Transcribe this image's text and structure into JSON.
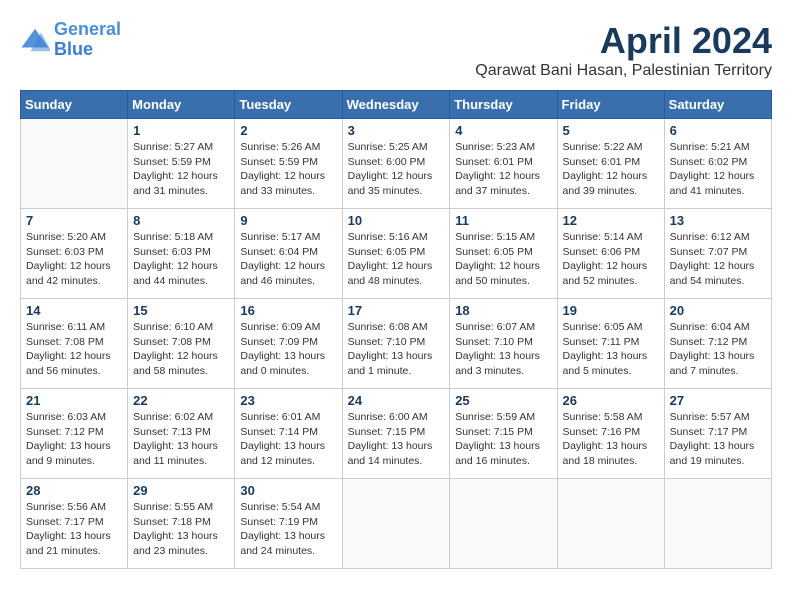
{
  "logo": {
    "line1": "General",
    "line2": "Blue"
  },
  "title": "April 2024",
  "location": "Qarawat Bani Hasan, Palestinian Territory",
  "headers": [
    "Sunday",
    "Monday",
    "Tuesday",
    "Wednesday",
    "Thursday",
    "Friday",
    "Saturday"
  ],
  "weeks": [
    [
      {
        "day": "",
        "info": ""
      },
      {
        "day": "1",
        "info": "Sunrise: 5:27 AM\nSunset: 5:59 PM\nDaylight: 12 hours\nand 31 minutes."
      },
      {
        "day": "2",
        "info": "Sunrise: 5:26 AM\nSunset: 5:59 PM\nDaylight: 12 hours\nand 33 minutes."
      },
      {
        "day": "3",
        "info": "Sunrise: 5:25 AM\nSunset: 6:00 PM\nDaylight: 12 hours\nand 35 minutes."
      },
      {
        "day": "4",
        "info": "Sunrise: 5:23 AM\nSunset: 6:01 PM\nDaylight: 12 hours\nand 37 minutes."
      },
      {
        "day": "5",
        "info": "Sunrise: 5:22 AM\nSunset: 6:01 PM\nDaylight: 12 hours\nand 39 minutes."
      },
      {
        "day": "6",
        "info": "Sunrise: 5:21 AM\nSunset: 6:02 PM\nDaylight: 12 hours\nand 41 minutes."
      }
    ],
    [
      {
        "day": "7",
        "info": "Sunrise: 5:20 AM\nSunset: 6:03 PM\nDaylight: 12 hours\nand 42 minutes."
      },
      {
        "day": "8",
        "info": "Sunrise: 5:18 AM\nSunset: 6:03 PM\nDaylight: 12 hours\nand 44 minutes."
      },
      {
        "day": "9",
        "info": "Sunrise: 5:17 AM\nSunset: 6:04 PM\nDaylight: 12 hours\nand 46 minutes."
      },
      {
        "day": "10",
        "info": "Sunrise: 5:16 AM\nSunset: 6:05 PM\nDaylight: 12 hours\nand 48 minutes."
      },
      {
        "day": "11",
        "info": "Sunrise: 5:15 AM\nSunset: 6:05 PM\nDaylight: 12 hours\nand 50 minutes."
      },
      {
        "day": "12",
        "info": "Sunrise: 5:14 AM\nSunset: 6:06 PM\nDaylight: 12 hours\nand 52 minutes."
      },
      {
        "day": "13",
        "info": "Sunrise: 6:12 AM\nSunset: 7:07 PM\nDaylight: 12 hours\nand 54 minutes."
      }
    ],
    [
      {
        "day": "14",
        "info": "Sunrise: 6:11 AM\nSunset: 7:08 PM\nDaylight: 12 hours\nand 56 minutes."
      },
      {
        "day": "15",
        "info": "Sunrise: 6:10 AM\nSunset: 7:08 PM\nDaylight: 12 hours\nand 58 minutes."
      },
      {
        "day": "16",
        "info": "Sunrise: 6:09 AM\nSunset: 7:09 PM\nDaylight: 13 hours\nand 0 minutes."
      },
      {
        "day": "17",
        "info": "Sunrise: 6:08 AM\nSunset: 7:10 PM\nDaylight: 13 hours\nand 1 minute."
      },
      {
        "day": "18",
        "info": "Sunrise: 6:07 AM\nSunset: 7:10 PM\nDaylight: 13 hours\nand 3 minutes."
      },
      {
        "day": "19",
        "info": "Sunrise: 6:05 AM\nSunset: 7:11 PM\nDaylight: 13 hours\nand 5 minutes."
      },
      {
        "day": "20",
        "info": "Sunrise: 6:04 AM\nSunset: 7:12 PM\nDaylight: 13 hours\nand 7 minutes."
      }
    ],
    [
      {
        "day": "21",
        "info": "Sunrise: 6:03 AM\nSunset: 7:12 PM\nDaylight: 13 hours\nand 9 minutes."
      },
      {
        "day": "22",
        "info": "Sunrise: 6:02 AM\nSunset: 7:13 PM\nDaylight: 13 hours\nand 11 minutes."
      },
      {
        "day": "23",
        "info": "Sunrise: 6:01 AM\nSunset: 7:14 PM\nDaylight: 13 hours\nand 12 minutes."
      },
      {
        "day": "24",
        "info": "Sunrise: 6:00 AM\nSunset: 7:15 PM\nDaylight: 13 hours\nand 14 minutes."
      },
      {
        "day": "25",
        "info": "Sunrise: 5:59 AM\nSunset: 7:15 PM\nDaylight: 13 hours\nand 16 minutes."
      },
      {
        "day": "26",
        "info": "Sunrise: 5:58 AM\nSunset: 7:16 PM\nDaylight: 13 hours\nand 18 minutes."
      },
      {
        "day": "27",
        "info": "Sunrise: 5:57 AM\nSunset: 7:17 PM\nDaylight: 13 hours\nand 19 minutes."
      }
    ],
    [
      {
        "day": "28",
        "info": "Sunrise: 5:56 AM\nSunset: 7:17 PM\nDaylight: 13 hours\nand 21 minutes."
      },
      {
        "day": "29",
        "info": "Sunrise: 5:55 AM\nSunset: 7:18 PM\nDaylight: 13 hours\nand 23 minutes."
      },
      {
        "day": "30",
        "info": "Sunrise: 5:54 AM\nSunset: 7:19 PM\nDaylight: 13 hours\nand 24 minutes."
      },
      {
        "day": "",
        "info": ""
      },
      {
        "day": "",
        "info": ""
      },
      {
        "day": "",
        "info": ""
      },
      {
        "day": "",
        "info": ""
      }
    ]
  ]
}
